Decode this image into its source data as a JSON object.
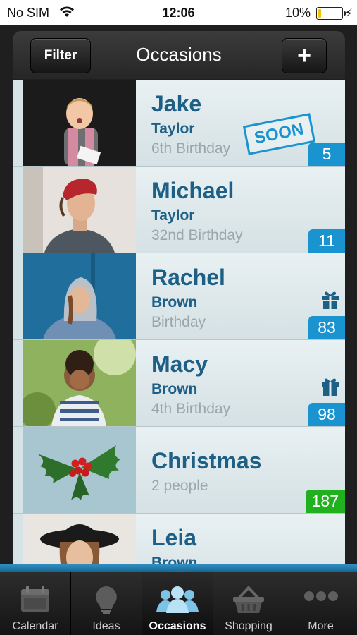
{
  "status": {
    "carrier": "No SIM",
    "time": "12:06",
    "battery": "10%"
  },
  "header": {
    "title": "Occasions",
    "filter_label": "Filter",
    "add_label": "+"
  },
  "occasions": [
    {
      "name": "Jake",
      "surname": "Taylor",
      "occasion": "6th Birthday",
      "days": "5",
      "badge": "SOON"
    },
    {
      "name": "Michael",
      "surname": "Taylor",
      "occasion": "32nd Birthday",
      "days": "11"
    },
    {
      "name": "Rachel",
      "surname": "Brown",
      "occasion": "Birthday",
      "days": "83",
      "icon": "gift-icon"
    },
    {
      "name": "Macy",
      "surname": "Brown",
      "occasion": "4th Birthday",
      "days": "98",
      "icon": "gift-icon"
    },
    {
      "name": "Christmas",
      "occasion": "2 people",
      "days": "187",
      "days_color": "#22b11e"
    },
    {
      "name": "Leia",
      "surname": "Brown"
    }
  ],
  "tabs": [
    {
      "label": "Calendar",
      "icon": "calendar-icon"
    },
    {
      "label": "Ideas",
      "icon": "lightbulb-icon"
    },
    {
      "label": "Occasions",
      "icon": "people-icon",
      "active": true
    },
    {
      "label": "Shopping",
      "icon": "basket-icon"
    },
    {
      "label": "More",
      "icon": "more-icon"
    }
  ],
  "colors": {
    "accent": "#1a93d1",
    "name_text": "#1e5f86",
    "green_badge": "#22b11e"
  }
}
